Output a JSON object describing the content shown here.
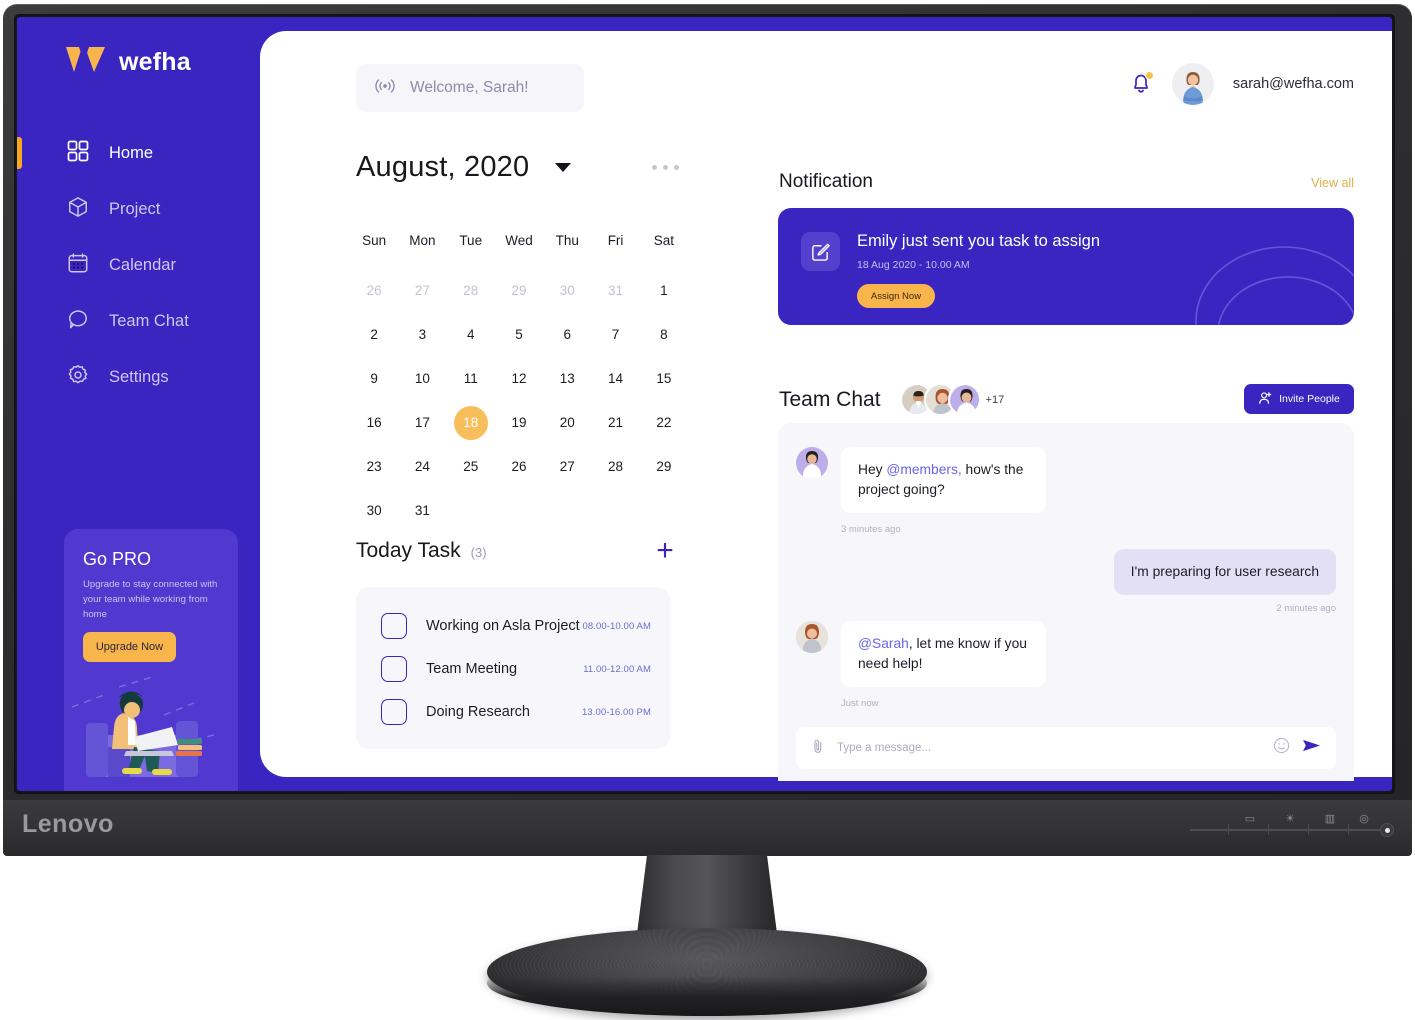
{
  "monitor": {
    "brand": "Lenovo",
    "osd_icons": [
      "input-icon",
      "brightness-icon",
      "layout-icon",
      "menu-icon",
      "power-icon"
    ]
  },
  "sidebar": {
    "brand": {
      "name": "wefha",
      "logo_icon": "wefha-logo-icon"
    },
    "items": [
      {
        "label": "Home",
        "icon": "grid-icon",
        "active": true
      },
      {
        "label": "Project",
        "icon": "cube-icon",
        "active": false
      },
      {
        "label": "Calendar",
        "icon": "calendar-icon",
        "active": false
      },
      {
        "label": "Team Chat",
        "icon": "chat-bubble-icon",
        "active": false
      },
      {
        "label": "Settings",
        "icon": "gear-icon",
        "active": false
      }
    ],
    "pro_card": {
      "title": "Go PRO",
      "description": "Upgrade to stay connected with your team while working from home",
      "button_label": "Upgrade Now"
    }
  },
  "header": {
    "welcome_text": "Welcome, Sarah!",
    "welcome_icon": "broadcast-icon",
    "bell_icon": "bell-icon",
    "avatar_icon": "user-avatar",
    "user_email": "sarah@wefha.com"
  },
  "calendar": {
    "title": "August, 2020",
    "caret_icon": "chevron-down-icon",
    "more_icon": "more-options-icon",
    "weekdays": [
      "Sun",
      "Mon",
      "Tue",
      "Wed",
      "Thu",
      "Fri",
      "Sat"
    ],
    "selected_day": 18,
    "days": [
      {
        "n": "26",
        "muted": true
      },
      {
        "n": "27",
        "muted": true
      },
      {
        "n": "28",
        "muted": true
      },
      {
        "n": "29",
        "muted": true
      },
      {
        "n": "30",
        "muted": true
      },
      {
        "n": "31",
        "muted": true
      },
      {
        "n": "1",
        "muted": false
      },
      {
        "n": "2",
        "muted": false
      },
      {
        "n": "3",
        "muted": false
      },
      {
        "n": "4",
        "muted": false
      },
      {
        "n": "5",
        "muted": false
      },
      {
        "n": "6",
        "muted": false
      },
      {
        "n": "7",
        "muted": false
      },
      {
        "n": "8",
        "muted": false
      },
      {
        "n": "9",
        "muted": false
      },
      {
        "n": "10",
        "muted": false
      },
      {
        "n": "11",
        "muted": false
      },
      {
        "n": "12",
        "muted": false
      },
      {
        "n": "13",
        "muted": false
      },
      {
        "n": "14",
        "muted": false
      },
      {
        "n": "15",
        "muted": false
      },
      {
        "n": "16",
        "muted": false
      },
      {
        "n": "17",
        "muted": false
      },
      {
        "n": "18",
        "muted": false,
        "selected": true
      },
      {
        "n": "19",
        "muted": false
      },
      {
        "n": "20",
        "muted": false
      },
      {
        "n": "21",
        "muted": false
      },
      {
        "n": "22",
        "muted": false
      },
      {
        "n": "23",
        "muted": false
      },
      {
        "n": "24",
        "muted": false
      },
      {
        "n": "25",
        "muted": false
      },
      {
        "n": "26",
        "muted": false
      },
      {
        "n": "27",
        "muted": false
      },
      {
        "n": "28",
        "muted": false
      },
      {
        "n": "29",
        "muted": false
      },
      {
        "n": "30",
        "muted": false
      },
      {
        "n": "31",
        "muted": false
      }
    ]
  },
  "today_task": {
    "title": "Today Task",
    "count": "(3)",
    "add_icon": "plus-icon",
    "items": [
      {
        "label": "Working on Asla Project",
        "time": "08.00-10.00 AM",
        "checked": false
      },
      {
        "label": "Team Meeting",
        "time": "11.00-12.00 AM",
        "checked": false
      },
      {
        "label": "Doing Research",
        "time": "13.00-16.00 PM",
        "checked": false
      }
    ]
  },
  "notification": {
    "title": "Notification",
    "view_all": "View all",
    "card": {
      "icon": "edit-square-icon",
      "message": "Emily just sent you task to assign",
      "timestamp": "18 Aug 2020 - 10.00 AM",
      "button_label": "Assign Now"
    }
  },
  "team_chat": {
    "title": "Team Chat",
    "avatar_overflow": "+17",
    "invite_button": {
      "label": "Invite People",
      "icon": "person-add-icon"
    },
    "messages": [
      {
        "side": "in",
        "mention": "@members,",
        "prefix": "Hey ",
        "suffix": " how's the project going?",
        "stamp": "3 minutes ago"
      },
      {
        "side": "out",
        "text": "I'm preparing for user research",
        "stamp": "2 minutes ago"
      },
      {
        "side": "in",
        "mention": "@Sarah",
        "prefix": "",
        "suffix": ", let me know if you need help!",
        "stamp": "Just now"
      }
    ],
    "composer": {
      "placeholder": "Type a message...",
      "attach_icon": "paperclip-icon",
      "emoji_icon": "emoji-icon",
      "send_icon": "send-icon"
    }
  },
  "colors": {
    "brand_purple": "#3B25C1",
    "accent_orange": "#F5A623",
    "accent_yellow": "#F8B54C",
    "selected_day": "#F9BE5C",
    "mention": "#6B63E8"
  }
}
